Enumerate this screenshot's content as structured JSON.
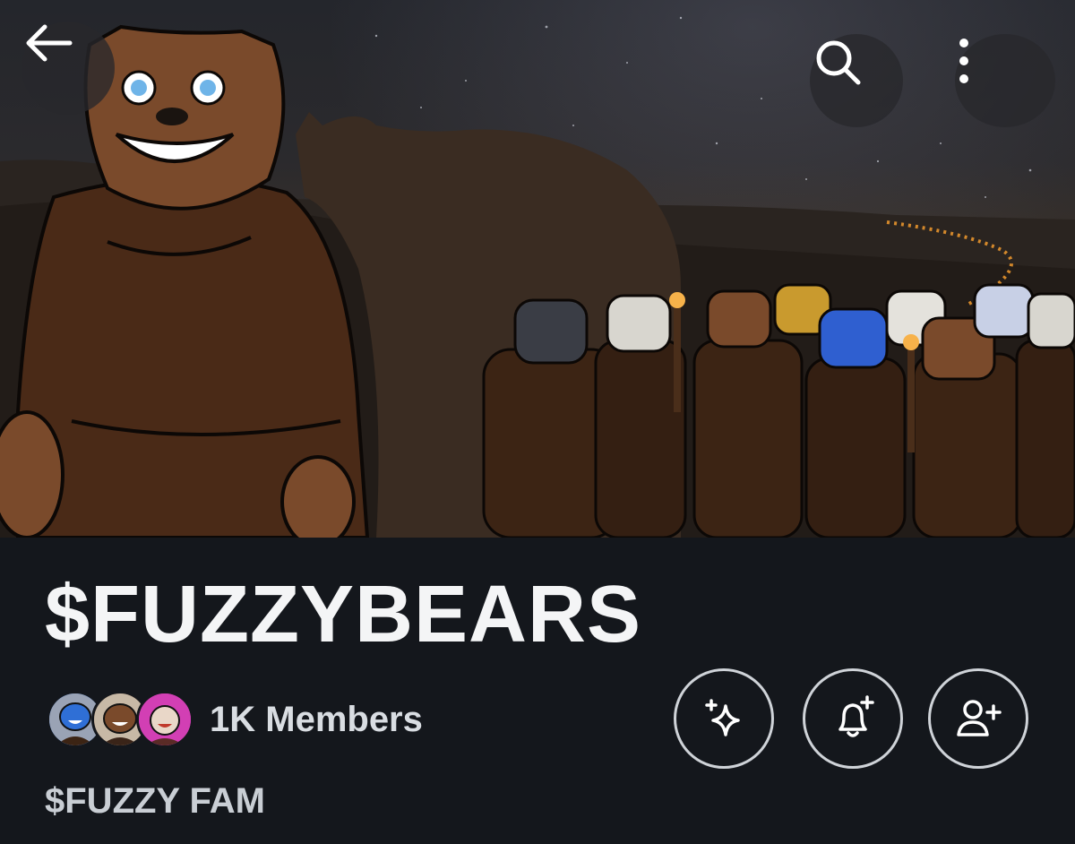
{
  "header": {
    "back_icon": "arrow-left-icon",
    "search_icon": "search-icon",
    "more_icon": "more-vertical-icon"
  },
  "community": {
    "name": "$FUZZYBEARS",
    "members_label": "1K Members",
    "description": "$FUZZY FAM"
  },
  "member_avatars": [
    {
      "name": "avatar-blue-bear",
      "color": "#2f6fd6"
    },
    {
      "name": "avatar-brown-bear",
      "color": "#7a4a2b"
    },
    {
      "name": "avatar-pink-bear",
      "color": "#d23fb4"
    }
  ],
  "actions": [
    {
      "name": "sparkle-button",
      "icon": "sparkle-icon"
    },
    {
      "name": "notification-bell-button",
      "icon": "bell-plus-icon"
    },
    {
      "name": "join-community-button",
      "icon": "person-plus-icon"
    }
  ],
  "colors": {
    "background": "#14171c",
    "title": "#f4f5f6",
    "muted_text": "#c9ced4",
    "button_border": "#cfd3d8"
  }
}
